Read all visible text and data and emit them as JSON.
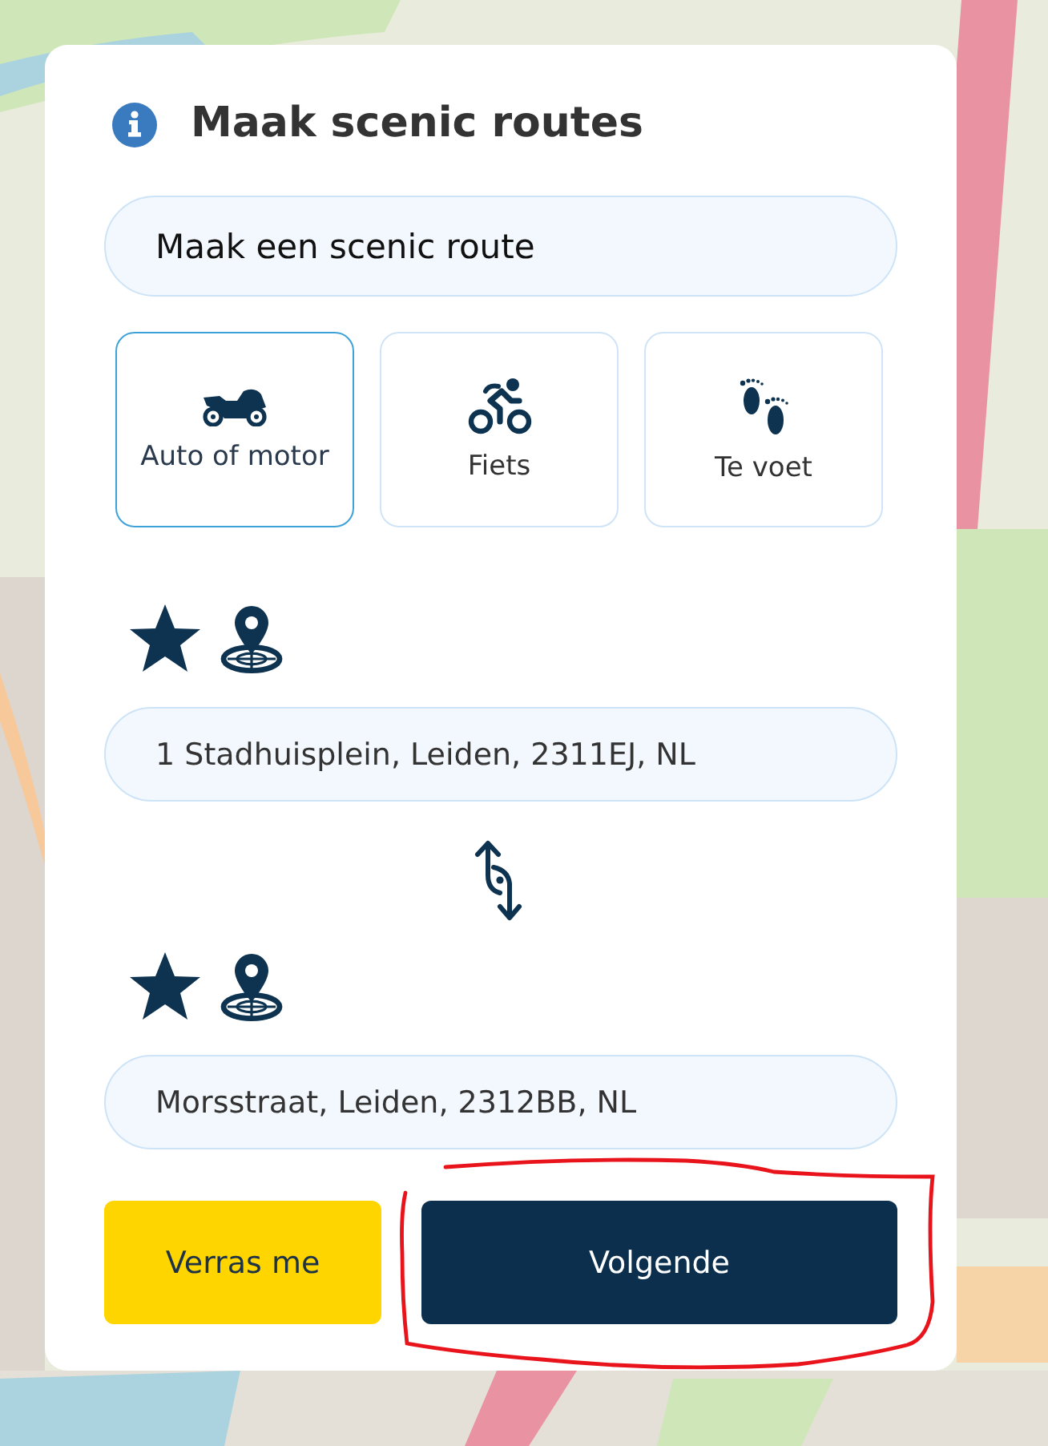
{
  "header": {
    "title": "Maak scenic routes"
  },
  "route_name": {
    "value": "Maak een scenic route"
  },
  "modes": [
    {
      "kind": "motorbike",
      "label": "Auto of motor",
      "selected": true
    },
    {
      "kind": "bicycle",
      "label": "Fiets",
      "selected": false
    },
    {
      "kind": "walking",
      "label": "Te voet",
      "selected": false
    }
  ],
  "waypoints": [
    {
      "value": "1 Stadhuisplein, Leiden, 2311EJ, NL"
    },
    {
      "value": "Morsstraat, Leiden, 2312BB, NL"
    }
  ],
  "actions": [
    {
      "kind": "secondary",
      "label": "Verras me",
      "highlighted": false
    },
    {
      "kind": "primary",
      "label": "Volgende",
      "highlighted": true
    }
  ]
}
